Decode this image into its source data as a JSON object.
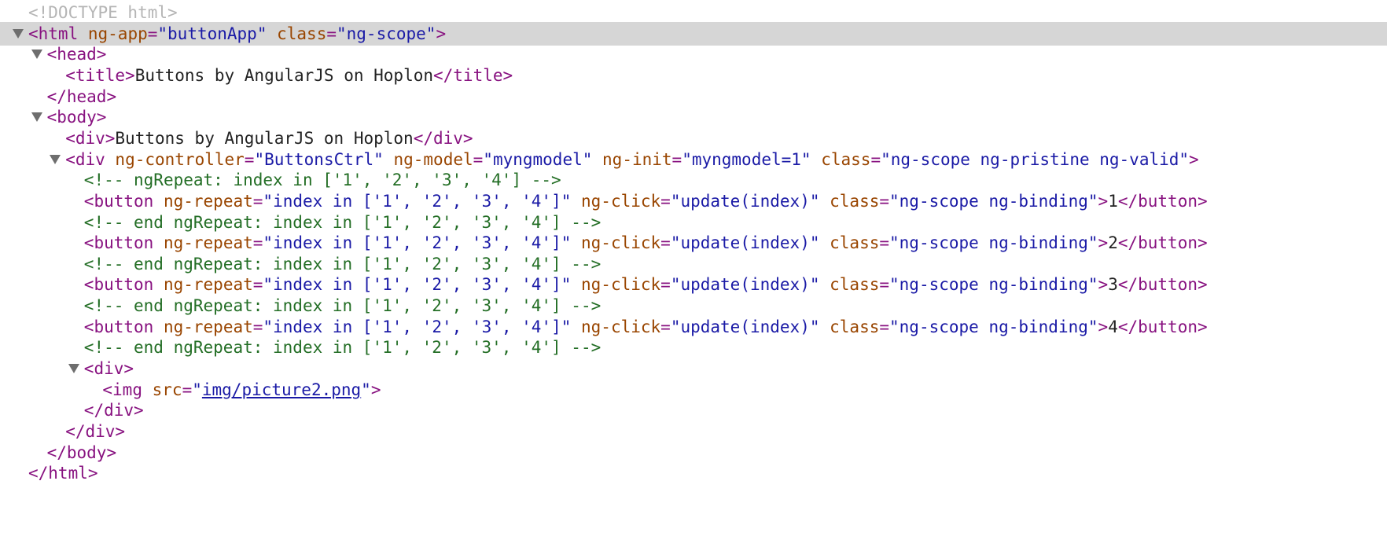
{
  "colors": {
    "tag": "#881280",
    "attribute": "#994500",
    "value": "#1a1aa6",
    "text": "#222222",
    "comment": "#236e25",
    "doctype": "#b5b5b5",
    "selected_row": "#d6d6d6"
  },
  "icons": {
    "disclosure": "triangle-down-icon"
  },
  "lines": [
    {
      "level": 0,
      "arrow": false,
      "selected": false,
      "segments": [
        {
          "c": "doctype",
          "t": "<!DOCTYPE html>"
        }
      ]
    },
    {
      "level": 0,
      "arrow": true,
      "selected": true,
      "segments": [
        {
          "c": "tag",
          "t": "<html"
        },
        {
          "c": "tag",
          "t": " "
        },
        {
          "c": "attr",
          "t": "ng-app"
        },
        {
          "c": "tag",
          "t": "="
        },
        {
          "c": "val",
          "t": "\"buttonApp\""
        },
        {
          "c": "tag",
          "t": " "
        },
        {
          "c": "attr",
          "t": "class"
        },
        {
          "c": "tag",
          "t": "="
        },
        {
          "c": "val",
          "t": "\"ng-scope\""
        },
        {
          "c": "tag",
          "t": ">"
        }
      ]
    },
    {
      "level": 1,
      "arrow": true,
      "selected": false,
      "segments": [
        {
          "c": "tag",
          "t": "<head>"
        }
      ]
    },
    {
      "level": 2,
      "arrow": false,
      "selected": false,
      "segments": [
        {
          "c": "tag",
          "t": "<title>"
        },
        {
          "c": "txt",
          "t": "Buttons by AngularJS on Hoplon"
        },
        {
          "c": "tag",
          "t": "</title>"
        }
      ]
    },
    {
      "level": 1,
      "arrow": false,
      "selected": false,
      "segments": [
        {
          "c": "tag",
          "t": "</head>"
        }
      ]
    },
    {
      "level": 1,
      "arrow": true,
      "selected": false,
      "segments": [
        {
          "c": "tag",
          "t": "<body>"
        }
      ]
    },
    {
      "level": 2,
      "arrow": false,
      "selected": false,
      "segments": [
        {
          "c": "tag",
          "t": "<div>"
        },
        {
          "c": "txt",
          "t": "Buttons by AngularJS on Hoplon"
        },
        {
          "c": "tag",
          "t": "</div>"
        }
      ]
    },
    {
      "level": 2,
      "arrow": true,
      "selected": false,
      "segments": [
        {
          "c": "tag",
          "t": "<div"
        },
        {
          "c": "tag",
          "t": " "
        },
        {
          "c": "attr",
          "t": "ng-controller"
        },
        {
          "c": "tag",
          "t": "="
        },
        {
          "c": "val",
          "t": "\"ButtonsCtrl\""
        },
        {
          "c": "tag",
          "t": " "
        },
        {
          "c": "attr",
          "t": "ng-model"
        },
        {
          "c": "tag",
          "t": "="
        },
        {
          "c": "val",
          "t": "\"myngmodel\""
        },
        {
          "c": "tag",
          "t": " "
        },
        {
          "c": "attr",
          "t": "ng-init"
        },
        {
          "c": "tag",
          "t": "="
        },
        {
          "c": "val",
          "t": "\"myngmodel=1\""
        },
        {
          "c": "tag",
          "t": " "
        },
        {
          "c": "attr",
          "t": "class"
        },
        {
          "c": "tag",
          "t": "="
        },
        {
          "c": "val",
          "t": "\"ng-scope ng-pristine ng-valid\""
        },
        {
          "c": "tag",
          "t": ">"
        }
      ]
    },
    {
      "level": 3,
      "arrow": false,
      "selected": false,
      "segments": [
        {
          "c": "cmt",
          "t": "<!-- ngRepeat: index in ['1', '2', '3', '4'] -->"
        }
      ]
    },
    {
      "level": 3,
      "arrow": false,
      "selected": false,
      "segments": [
        {
          "c": "tag",
          "t": "<button"
        },
        {
          "c": "tag",
          "t": " "
        },
        {
          "c": "attr",
          "t": "ng-repeat"
        },
        {
          "c": "tag",
          "t": "="
        },
        {
          "c": "val",
          "t": "\"index in ['1', '2', '3', '4']\""
        },
        {
          "c": "tag",
          "t": " "
        },
        {
          "c": "attr",
          "t": "ng-click"
        },
        {
          "c": "tag",
          "t": "="
        },
        {
          "c": "val",
          "t": "\"update(index)\""
        },
        {
          "c": "tag",
          "t": " "
        },
        {
          "c": "attr",
          "t": "class"
        },
        {
          "c": "tag",
          "t": "="
        },
        {
          "c": "val",
          "t": "\"ng-scope ng-binding\""
        },
        {
          "c": "tag",
          "t": ">"
        },
        {
          "c": "txt",
          "t": "1"
        },
        {
          "c": "tag",
          "t": "</button>"
        }
      ]
    },
    {
      "level": 3,
      "arrow": false,
      "selected": false,
      "segments": [
        {
          "c": "cmt",
          "t": "<!-- end ngRepeat: index in ['1', '2', '3', '4'] -->"
        }
      ]
    },
    {
      "level": 3,
      "arrow": false,
      "selected": false,
      "segments": [
        {
          "c": "tag",
          "t": "<button"
        },
        {
          "c": "tag",
          "t": " "
        },
        {
          "c": "attr",
          "t": "ng-repeat"
        },
        {
          "c": "tag",
          "t": "="
        },
        {
          "c": "val",
          "t": "\"index in ['1', '2', '3', '4']\""
        },
        {
          "c": "tag",
          "t": " "
        },
        {
          "c": "attr",
          "t": "ng-click"
        },
        {
          "c": "tag",
          "t": "="
        },
        {
          "c": "val",
          "t": "\"update(index)\""
        },
        {
          "c": "tag",
          "t": " "
        },
        {
          "c": "attr",
          "t": "class"
        },
        {
          "c": "tag",
          "t": "="
        },
        {
          "c": "val",
          "t": "\"ng-scope ng-binding\""
        },
        {
          "c": "tag",
          "t": ">"
        },
        {
          "c": "txt",
          "t": "2"
        },
        {
          "c": "tag",
          "t": "</button>"
        }
      ]
    },
    {
      "level": 3,
      "arrow": false,
      "selected": false,
      "segments": [
        {
          "c": "cmt",
          "t": "<!-- end ngRepeat: index in ['1', '2', '3', '4'] -->"
        }
      ]
    },
    {
      "level": 3,
      "arrow": false,
      "selected": false,
      "segments": [
        {
          "c": "tag",
          "t": "<button"
        },
        {
          "c": "tag",
          "t": " "
        },
        {
          "c": "attr",
          "t": "ng-repeat"
        },
        {
          "c": "tag",
          "t": "="
        },
        {
          "c": "val",
          "t": "\"index in ['1', '2', '3', '4']\""
        },
        {
          "c": "tag",
          "t": " "
        },
        {
          "c": "attr",
          "t": "ng-click"
        },
        {
          "c": "tag",
          "t": "="
        },
        {
          "c": "val",
          "t": "\"update(index)\""
        },
        {
          "c": "tag",
          "t": " "
        },
        {
          "c": "attr",
          "t": "class"
        },
        {
          "c": "tag",
          "t": "="
        },
        {
          "c": "val",
          "t": "\"ng-scope ng-binding\""
        },
        {
          "c": "tag",
          "t": ">"
        },
        {
          "c": "txt",
          "t": "3"
        },
        {
          "c": "tag",
          "t": "</button>"
        }
      ]
    },
    {
      "level": 3,
      "arrow": false,
      "selected": false,
      "segments": [
        {
          "c": "cmt",
          "t": "<!-- end ngRepeat: index in ['1', '2', '3', '4'] -->"
        }
      ]
    },
    {
      "level": 3,
      "arrow": false,
      "selected": false,
      "segments": [
        {
          "c": "tag",
          "t": "<button"
        },
        {
          "c": "tag",
          "t": " "
        },
        {
          "c": "attr",
          "t": "ng-repeat"
        },
        {
          "c": "tag",
          "t": "="
        },
        {
          "c": "val",
          "t": "\"index in ['1', '2', '3', '4']\""
        },
        {
          "c": "tag",
          "t": " "
        },
        {
          "c": "attr",
          "t": "ng-click"
        },
        {
          "c": "tag",
          "t": "="
        },
        {
          "c": "val",
          "t": "\"update(index)\""
        },
        {
          "c": "tag",
          "t": " "
        },
        {
          "c": "attr",
          "t": "class"
        },
        {
          "c": "tag",
          "t": "="
        },
        {
          "c": "val",
          "t": "\"ng-scope ng-binding\""
        },
        {
          "c": "tag",
          "t": ">"
        },
        {
          "c": "txt",
          "t": "4"
        },
        {
          "c": "tag",
          "t": "</button>"
        }
      ]
    },
    {
      "level": 3,
      "arrow": false,
      "selected": false,
      "segments": [
        {
          "c": "cmt",
          "t": "<!-- end ngRepeat: index in ['1', '2', '3', '4'] -->"
        }
      ]
    },
    {
      "level": 3,
      "arrow": true,
      "selected": false,
      "segments": [
        {
          "c": "tag",
          "t": "<div>"
        }
      ]
    },
    {
      "level": 4,
      "arrow": false,
      "selected": false,
      "segments": [
        {
          "c": "tag",
          "t": "<img"
        },
        {
          "c": "tag",
          "t": " "
        },
        {
          "c": "attr",
          "t": "src"
        },
        {
          "c": "tag",
          "t": "="
        },
        {
          "c": "val",
          "t": "\""
        },
        {
          "c": "link",
          "t": "img/picture2.png"
        },
        {
          "c": "val",
          "t": "\""
        },
        {
          "c": "tag",
          "t": ">"
        }
      ]
    },
    {
      "level": 3,
      "arrow": false,
      "selected": false,
      "segments": [
        {
          "c": "tag",
          "t": "</div>"
        }
      ]
    },
    {
      "level": 2,
      "arrow": false,
      "selected": false,
      "segments": [
        {
          "c": "tag",
          "t": "</div>"
        }
      ]
    },
    {
      "level": 1,
      "arrow": false,
      "selected": false,
      "segments": [
        {
          "c": "tag",
          "t": "</body>"
        }
      ]
    },
    {
      "level": 0,
      "arrow": false,
      "selected": false,
      "segments": [
        {
          "c": "tag",
          "t": "</html>"
        }
      ]
    }
  ]
}
